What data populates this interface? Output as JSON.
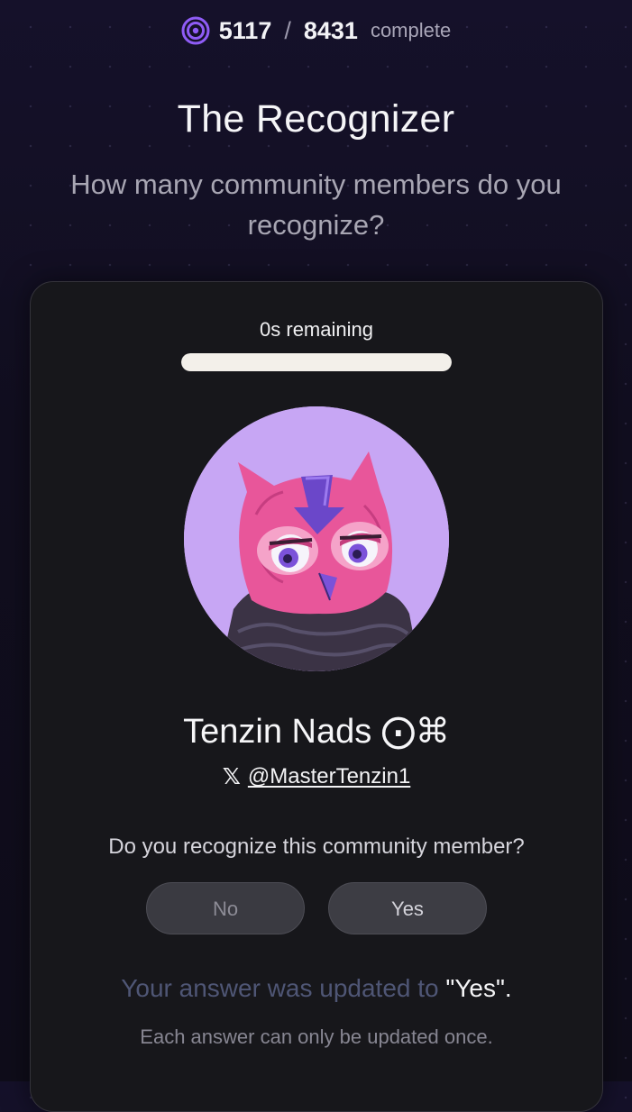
{
  "progress": {
    "icon": "target-icon",
    "done": "5117",
    "separator": "/",
    "total": "8431",
    "label": "complete",
    "accent_color": "#8f5cf6"
  },
  "page": {
    "title": "The Recognizer",
    "subtitle": "How many community members do you recognize?"
  },
  "card": {
    "timer_label": "0s remaining",
    "timer_fraction_filled": 1.0,
    "avatar": "owl-avatar",
    "member_name": "Tenzin Nads ⨀⌘",
    "x_icon": "𝕏",
    "handle": "@MasterTenzin1",
    "question": "Do you recognize this community member?",
    "buttons": {
      "no_label": "No",
      "yes_label": "Yes"
    },
    "updated_prefix": "Your answer was updated to ",
    "updated_value": "\"Yes\".",
    "note": "Each answer can only be updated once."
  }
}
